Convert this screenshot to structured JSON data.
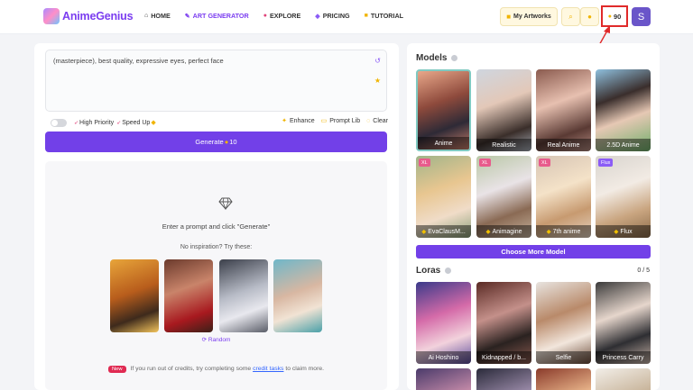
{
  "header": {
    "logo_text": "AnimeGenius",
    "nav": [
      {
        "label": "HOME",
        "icon": "home-icon"
      },
      {
        "label": "ART GENERATOR",
        "icon": "palette-icon"
      },
      {
        "label": "EXPLORE",
        "icon": "compass-icon"
      },
      {
        "label": "PRICING",
        "icon": "diamond-icon"
      },
      {
        "label": "TUTORIAL",
        "icon": "book-icon"
      }
    ],
    "my_artworks": "My Artworks",
    "credits": "90",
    "avatar_letter": "S"
  },
  "prompt": {
    "text": "(masterpiece), best quality, expressive eyes, perfect face"
  },
  "options": {
    "high_priority": "High Priority",
    "speed_up": "Speed Up",
    "enhance": "Enhance",
    "prompt_lib": "Prompt Lib",
    "clear": "Clear"
  },
  "generate": {
    "label": "Generate",
    "cost": "10"
  },
  "empty_state": {
    "message": "Enter a prompt and click \"Generate\"",
    "no_inspiration": "No inspiration? Try these:",
    "random": "Random",
    "new_badge": "New",
    "tip_before": "If you run out of credits, try completing some",
    "tip_link": "credit tasks",
    "tip_after": "to claim more."
  },
  "models": {
    "title": "Models",
    "items": [
      {
        "label": "Anime",
        "badge": "",
        "gem": false,
        "selected": true
      },
      {
        "label": "Realistic",
        "badge": "",
        "gem": false,
        "selected": false
      },
      {
        "label": "Real Anime",
        "badge": "",
        "gem": false,
        "selected": false
      },
      {
        "label": "2.5D Anime",
        "badge": "",
        "gem": false,
        "selected": false
      },
      {
        "label": "EvaClausM...",
        "badge": "XL",
        "gem": true,
        "selected": false
      },
      {
        "label": "Animagine",
        "badge": "XL",
        "gem": true,
        "selected": false
      },
      {
        "label": "7th anime",
        "badge": "XL",
        "gem": true,
        "selected": false
      },
      {
        "label": "Flux",
        "badge": "Flux",
        "gem": true,
        "selected": false
      }
    ],
    "choose_more": "Choose More Model"
  },
  "loras": {
    "title": "Loras",
    "count": "0 / 5",
    "items": [
      {
        "label": "Ai Hoshino"
      },
      {
        "label": "Kidnapped / b..."
      },
      {
        "label": "Selfie"
      },
      {
        "label": "Princess Carry"
      }
    ]
  },
  "colors": {
    "accent": "#7240e8",
    "highlight": "#e02a2a",
    "gold": "#f0b400"
  }
}
